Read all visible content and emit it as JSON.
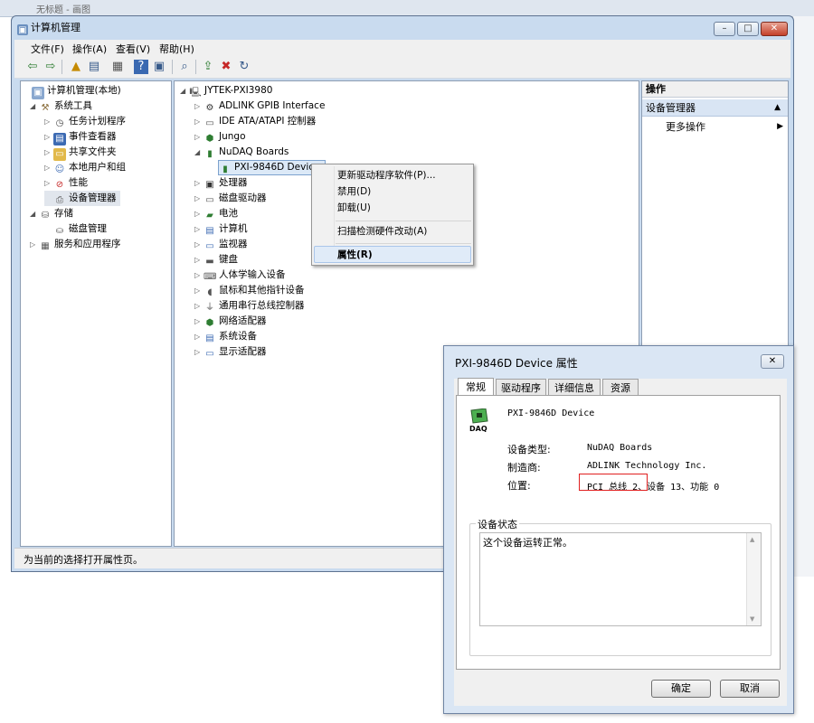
{
  "background_window": {
    "title": "无标题 - 画图"
  },
  "main_window": {
    "title": "计算机管理",
    "menu": [
      "文件(F)",
      "操作(A)",
      "查看(V)",
      "帮助(H)"
    ],
    "status_text": "为当前的选择打开属性页。"
  },
  "left_tree": [
    {
      "label": "计算机管理(本地)",
      "icon": "computer-management-icon"
    },
    {
      "label": "系统工具",
      "icon": "tools-icon"
    },
    {
      "label": "任务计划程序",
      "icon": "clock-icon"
    },
    {
      "label": "事件查看器",
      "icon": "event-viewer-icon"
    },
    {
      "label": "共享文件夹",
      "icon": "shared-folder-icon"
    },
    {
      "label": "本地用户和组",
      "icon": "users-icon"
    },
    {
      "label": "性能",
      "icon": "performance-icon"
    },
    {
      "label": "设备管理器",
      "icon": "device-manager-icon"
    },
    {
      "label": "存储",
      "icon": "storage-icon"
    },
    {
      "label": "磁盘管理",
      "icon": "disk-icon"
    },
    {
      "label": "服务和应用程序",
      "icon": "services-icon"
    }
  ],
  "device_tree": {
    "root": "JYTEK-PXI3980",
    "items": [
      {
        "label": "ADLINK GPIB Interface",
        "icon": "gpib-icon"
      },
      {
        "label": "IDE ATA/ATAPI 控制器",
        "icon": "ide-icon"
      },
      {
        "label": "Jungo",
        "icon": "jungo-icon"
      },
      {
        "label": "NuDAQ Boards",
        "icon": "board-icon"
      },
      {
        "label": "PXI-9846D Device",
        "icon": "daq-icon"
      },
      {
        "label": "处理器",
        "icon": "cpu-icon"
      },
      {
        "label": "磁盘驱动器",
        "icon": "disk-drive-icon"
      },
      {
        "label": "电池",
        "icon": "battery-icon"
      },
      {
        "label": "计算机",
        "icon": "computer-icon"
      },
      {
        "label": "监视器",
        "icon": "monitor-icon"
      },
      {
        "label": "键盘",
        "icon": "keyboard-icon"
      },
      {
        "label": "人体学输入设备",
        "icon": "hid-icon"
      },
      {
        "label": "鼠标和其他指针设备",
        "icon": "mouse-icon"
      },
      {
        "label": "通用串行总线控制器",
        "icon": "usb-icon"
      },
      {
        "label": "网络适配器",
        "icon": "network-icon"
      },
      {
        "label": "系统设备",
        "icon": "system-device-icon"
      },
      {
        "label": "显示适配器",
        "icon": "display-adapter-icon"
      }
    ]
  },
  "actions_pane": {
    "header": "操作",
    "section": "设备管理器",
    "more": "更多操作"
  },
  "context_menu": {
    "items": [
      "更新驱动程序软件(P)...",
      "禁用(D)",
      "卸载(U)",
      "扫描检测硬件改动(A)",
      "属性(R)"
    ],
    "highlighted": "属性(R)"
  },
  "dialog": {
    "title": "PXI-9846D Device 属性",
    "tabs": [
      "常规",
      "驱动程序",
      "详细信息",
      "资源"
    ],
    "active_tab": "常规",
    "icon_label": "DAQ",
    "device_name": "PXI-9846D Device",
    "device_type_label": "设备类型:",
    "device_type": "NuDAQ Boards",
    "manufacturer_label": "制造商:",
    "manufacturer": "ADLINK Technology Inc.",
    "location_label": "位置:",
    "location_bus": "PCI 总线 2、",
    "location_rest": "设备 13、功能 0",
    "status_group": "设备状态",
    "status_text": "这个设备运转正常。",
    "ok": "确定",
    "cancel": "取消"
  },
  "colors": {
    "window_frame": "#c9dbef",
    "selection": "#cce4f7",
    "highlight_border": "#e02020"
  }
}
